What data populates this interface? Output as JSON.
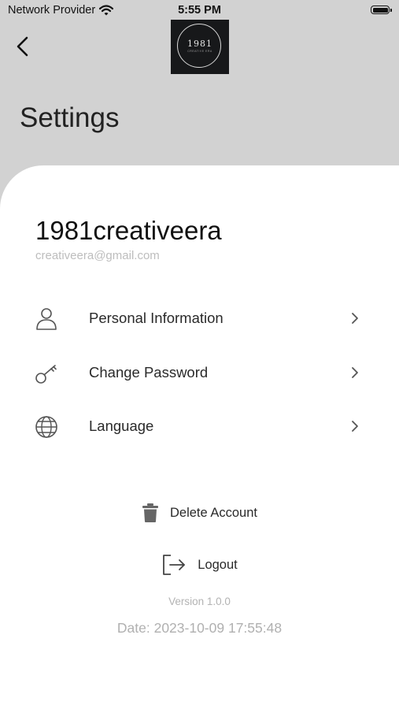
{
  "status_bar": {
    "carrier": "Network Provider",
    "time": "5:55 PM",
    "wifi_icon": "wifi-icon",
    "battery_icon": "battery-icon",
    "battery_level": 1.0
  },
  "header": {
    "back_icon": "chevron-left-icon",
    "logo": {
      "text": "1981",
      "subtext": "CREATIVE ERA"
    },
    "title": "Settings"
  },
  "profile": {
    "username": "1981creativeera",
    "email": "creativeera@gmail.com"
  },
  "menu": [
    {
      "label": "Personal Information",
      "icon": "person-icon"
    },
    {
      "label": "Change Password",
      "icon": "key-icon"
    },
    {
      "label": "Language",
      "icon": "globe-icon"
    }
  ],
  "actions": {
    "delete_label": "Delete Account",
    "delete_icon": "trash-icon",
    "logout_label": "Logout",
    "logout_icon": "logout-icon"
  },
  "footer": {
    "version": "Version 1.0.0",
    "date": "Date: 2023-10-09 17:55:48"
  },
  "colors": {
    "header_background": "#d2d2d2",
    "card_background": "#ffffff",
    "muted_text": "#b0b0b0"
  }
}
